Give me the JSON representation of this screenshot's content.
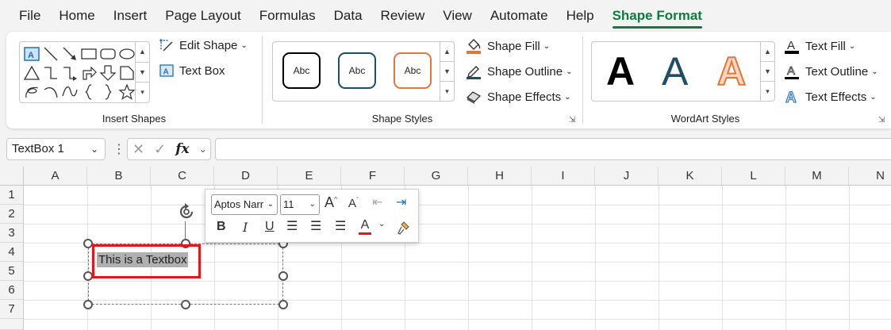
{
  "menu": {
    "tabs": [
      "File",
      "Home",
      "Insert",
      "Page Layout",
      "Formulas",
      "Data",
      "Review",
      "View",
      "Automate",
      "Help",
      "Shape Format"
    ],
    "active": "Shape Format"
  },
  "ribbon": {
    "insert_shapes": {
      "label": "Insert Shapes",
      "edit_shape": "Edit Shape",
      "text_box": "Text Box"
    },
    "shape_styles": {
      "label": "Shape Styles",
      "style_samples": [
        "Abc",
        "Abc",
        "Abc"
      ],
      "style_colors": [
        "#000000",
        "#1f4e67",
        "#e5763b"
      ],
      "shape_fill": "Shape Fill",
      "shape_outline": "Shape Outline",
      "shape_effects": "Shape Effects"
    },
    "wordart_styles": {
      "label": "WordArt Styles",
      "samples": [
        "A",
        "A",
        "A"
      ],
      "text_fill": "Text Fill",
      "text_outline": "Text Outline",
      "text_effects": "Text Effects"
    }
  },
  "formula_bar": {
    "name_box": "TextBox 1",
    "fx": "fx",
    "value": ""
  },
  "sheet": {
    "columns": [
      "A",
      "B",
      "C",
      "D",
      "E",
      "F",
      "G",
      "H",
      "I",
      "J",
      "K",
      "L",
      "M",
      "N"
    ],
    "rows": [
      "1",
      "2",
      "3",
      "4",
      "5",
      "6",
      "7"
    ]
  },
  "textbox": {
    "text": "This is a Textbox"
  },
  "mini_toolbar": {
    "font": "Aptos Narr",
    "size": "11",
    "bold": "B",
    "italic": "I",
    "underline": "U"
  }
}
